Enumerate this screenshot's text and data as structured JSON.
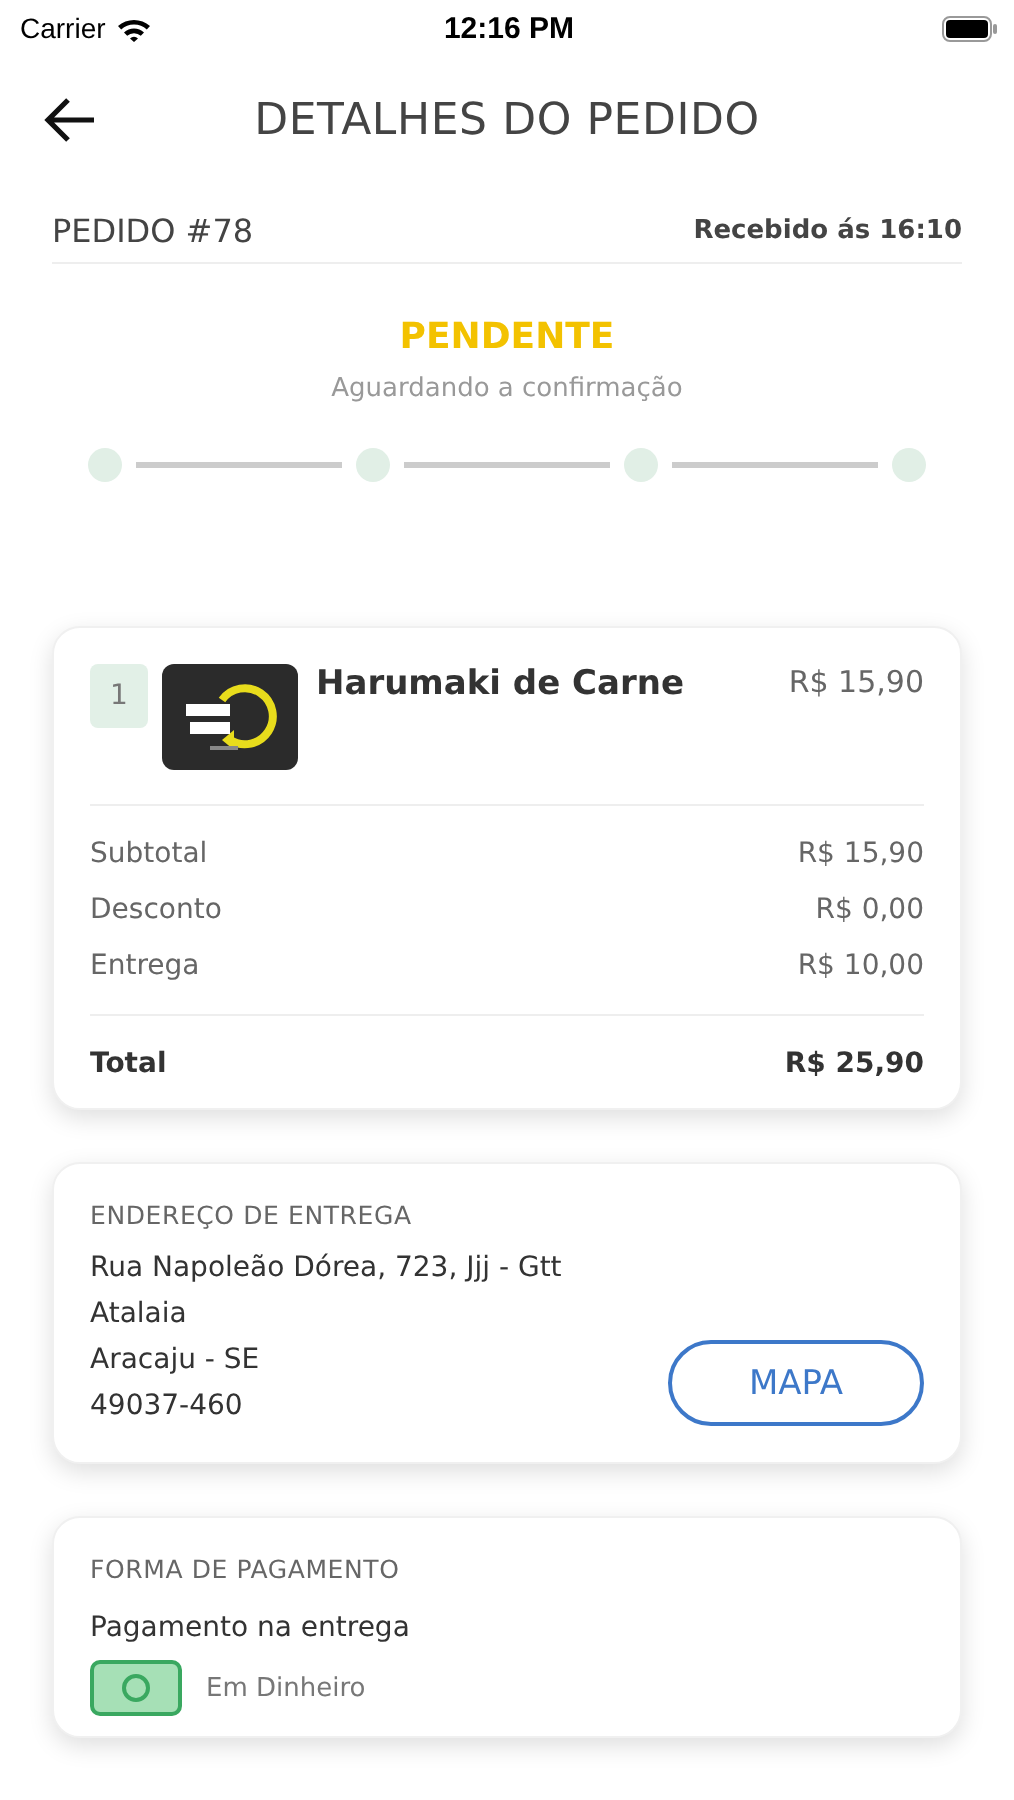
{
  "status_bar": {
    "carrier": "Carrier",
    "time": "12:16 PM"
  },
  "header": {
    "title": "DETALHES DO PEDIDO"
  },
  "order": {
    "number": "PEDIDO #78",
    "received": "Recebido ás 16:10"
  },
  "status": {
    "label": "PENDENTE",
    "description": "Aguardando a confirmação"
  },
  "steps": [
    {
      "done": false
    },
    {
      "done": false
    },
    {
      "done": false
    },
    {
      "done": false
    }
  ],
  "items": [
    {
      "quantity": "1",
      "name": "Harumaki de Carne",
      "price": "R$ 15,90"
    }
  ],
  "summary": [
    {
      "label": "Subtotal",
      "value": "R$ 15,90"
    },
    {
      "label": "Desconto",
      "value": "R$ 0,00"
    },
    {
      "label": "Entrega",
      "value": "R$ 10,00"
    }
  ],
  "total": {
    "label": "Total",
    "value": "R$ 25,90"
  },
  "address": {
    "heading": "ENDEREÇO DE ENTREGA",
    "lines": [
      "Rua Napoleão Dórea, 723, Jjj - Gtt",
      "Atalaia",
      "Aracaju - SE",
      "49037-460"
    ],
    "button": "MAPA"
  },
  "payment": {
    "heading": "FORMA DE PAGAMENTO",
    "type": "Pagamento na entrega",
    "method": "Em Dinheiro"
  }
}
